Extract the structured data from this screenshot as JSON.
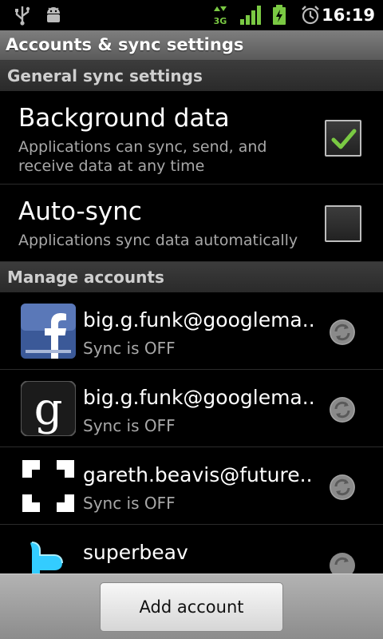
{
  "status_bar": {
    "time": "16:19",
    "network_label": "3G",
    "icons": [
      "usb-icon",
      "android-debug-icon",
      "3g-icon",
      "signal-icon",
      "battery-charging-icon",
      "alarm-icon"
    ]
  },
  "title_bar": {
    "title": "Accounts & sync settings"
  },
  "general_sync": {
    "header": "General sync settings",
    "background_data": {
      "title": "Background data",
      "summary": "Applications can sync, send, and receive data at any time",
      "checked": true
    },
    "auto_sync": {
      "title": "Auto-sync",
      "summary": "Applications sync data automatically",
      "checked": false
    }
  },
  "manage_accounts": {
    "header": "Manage accounts",
    "accounts": [
      {
        "name": "big.g.funk@googlema...",
        "status": "Sync is OFF",
        "icon": "facebook-icon"
      },
      {
        "name": "big.g.funk@googlema...",
        "status": "Sync is OFF",
        "icon": "google-icon"
      },
      {
        "name": "gareth.beavis@future...",
        "status": "Sync is OFF",
        "icon": "exchange-corners-icon"
      },
      {
        "name": "superbeav",
        "status": "",
        "icon": "twitter-icon"
      }
    ]
  },
  "bottom": {
    "add_account_label": "Add account"
  },
  "colors": {
    "check_green": "#7ac943",
    "facebook_blue": "#3b5998",
    "twitter_blue": "#33ccff"
  }
}
